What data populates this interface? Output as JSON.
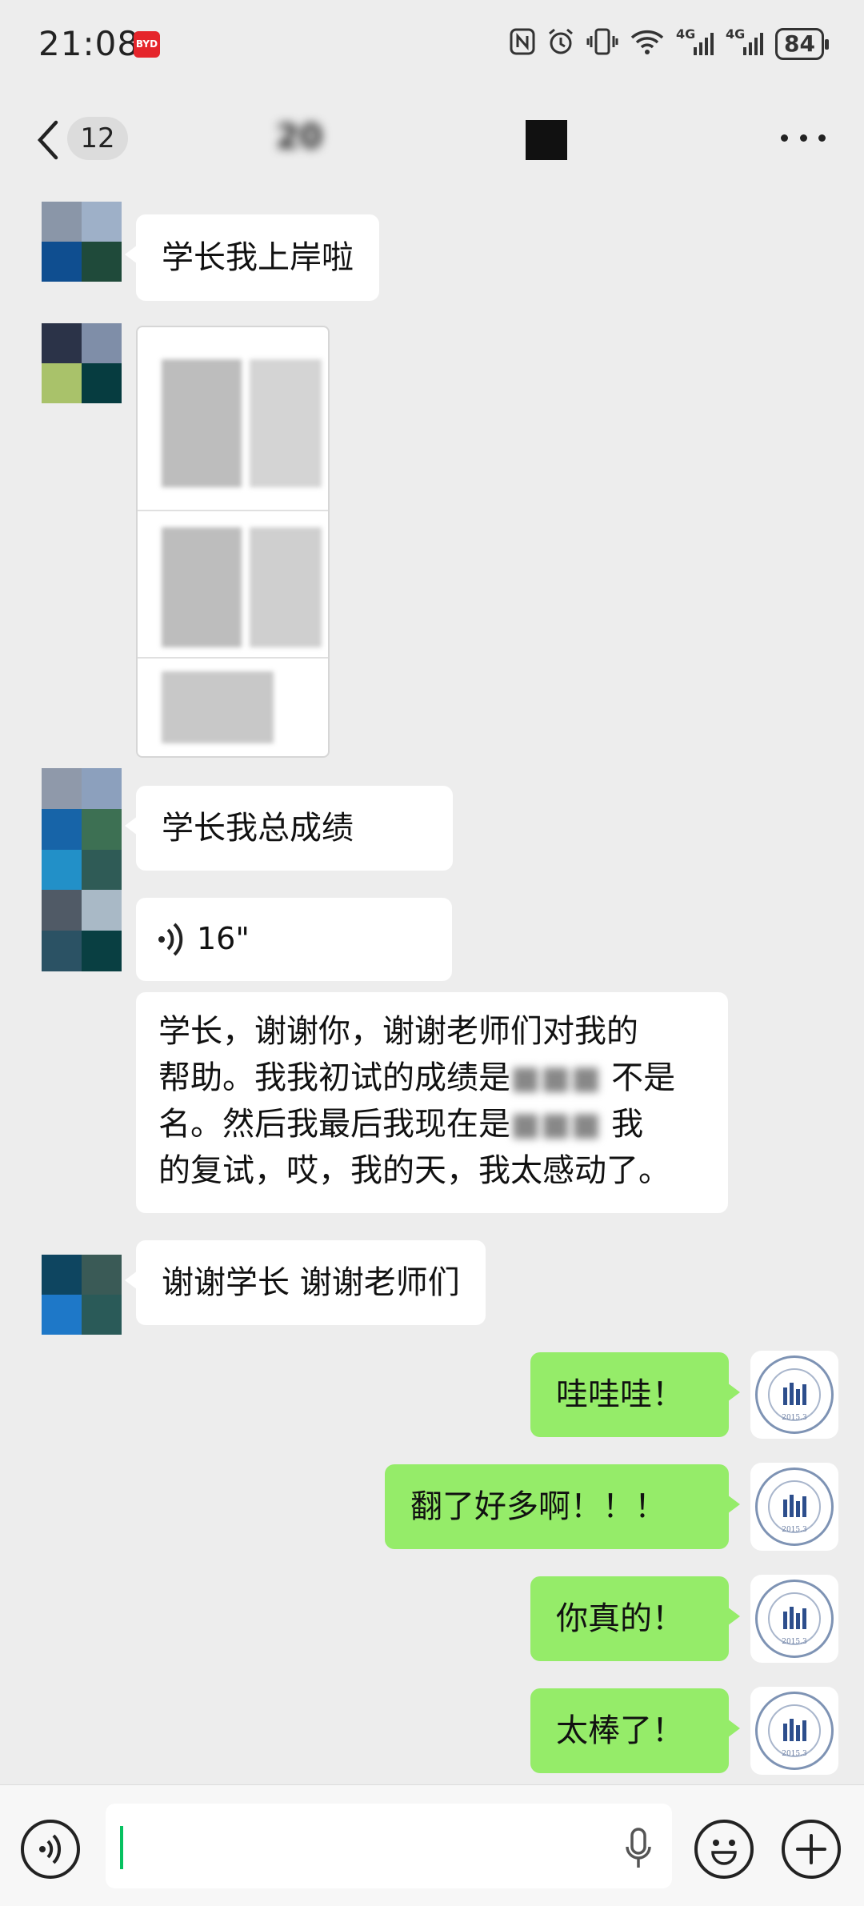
{
  "status_bar": {
    "time": "21:08",
    "car_logo_text": "BYD",
    "battery": "84",
    "network_1": "4G",
    "network_2": "4G"
  },
  "header": {
    "unread_count": "12",
    "chat_title_visible": "20"
  },
  "messages": {
    "m1": "学长我上岸啦",
    "m3": "学长我总成绩",
    "voice_duration": "16\"",
    "m5_line1": "学长，谢谢你，谢谢老师们对我的",
    "m5_line2": "帮助。我我初试的成绩是",
    "m5_line2b": "不是",
    "m5_line3": "名。然后我最后我现在是",
    "m5_line3b": "我",
    "m5_line4": "的复试，哎，我的天，我太感动了。",
    "m6": "谢谢学长 谢谢老师们",
    "r1": "哇哇哇！",
    "r2": "翻了好多啊！！！",
    "r3": "你真的！",
    "r4": "太棒了！"
  },
  "logo": {
    "year": "2015.3"
  },
  "colors": {
    "bg": "#ededed",
    "sent": "#95ec69",
    "received": "#ffffff",
    "caret": "#07c160"
  }
}
